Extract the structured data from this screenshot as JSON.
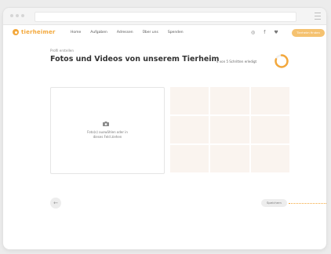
{
  "nav": {
    "logo_text": "tierheimer",
    "links": [
      "Home",
      "Aufgaben",
      "Adressen",
      "Über uns",
      "Spenden"
    ],
    "social_icons": [
      "globe-icon",
      "facebook-icon",
      "twitter-icon"
    ],
    "cta_label": "Tierheim finden"
  },
  "page": {
    "subtitle": "Profil erstellen",
    "title": "Fotos und Videos von unserem Tierheim",
    "progress_text": "4 von 5 Schritten erledigt",
    "progress_fraction": 0.8
  },
  "upload": {
    "line1": "Foto(s) auswählen oder in",
    "line2": "dieses Feld ziehen",
    "icon": "camera-icon"
  },
  "grid": {
    "cells": 9
  },
  "footer": {
    "back_label": "←",
    "save_label": "Speichern"
  },
  "colors": {
    "accent": "#f3a83c",
    "tile": "#faf4ef"
  }
}
